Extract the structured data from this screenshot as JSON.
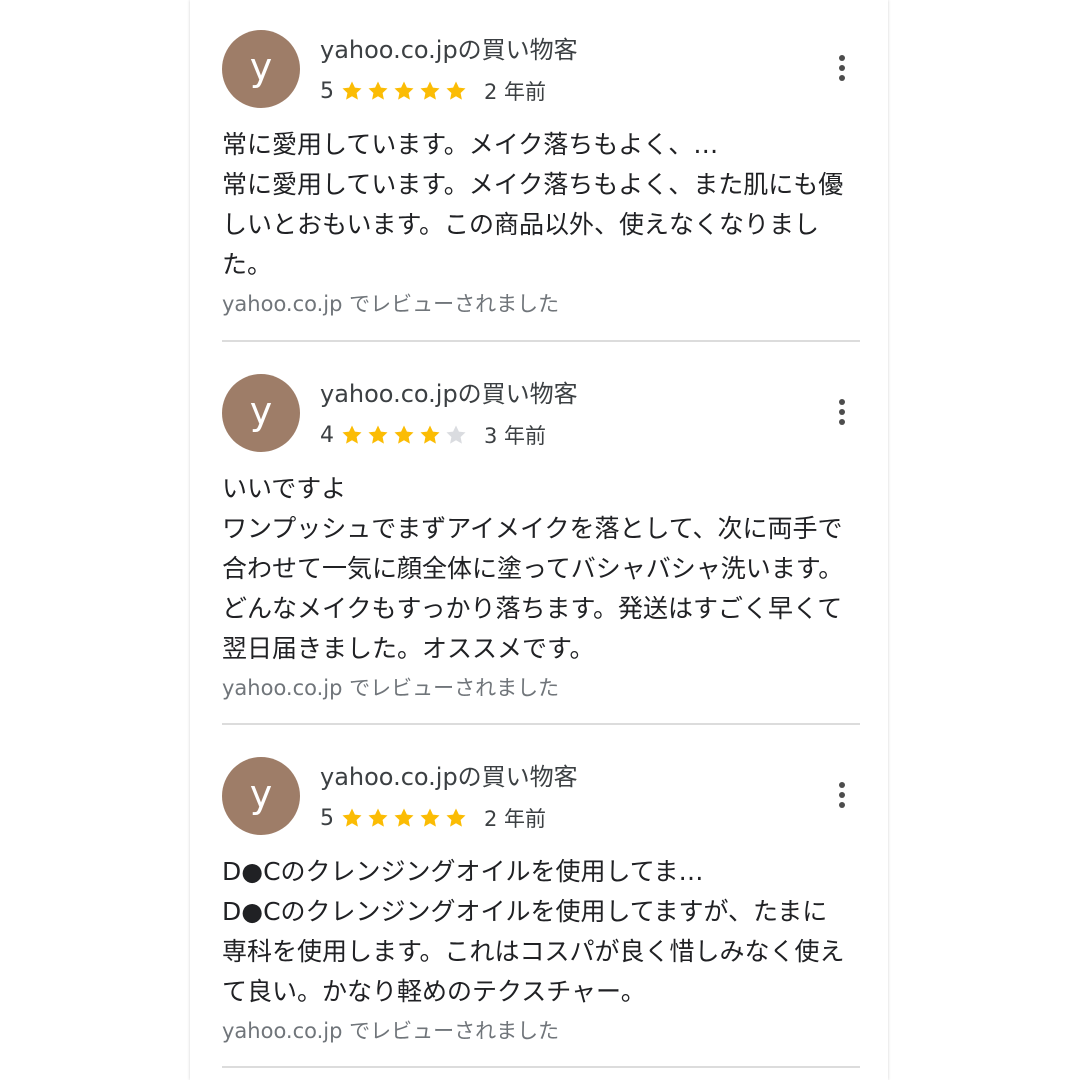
{
  "colors": {
    "avatar_bg": "#9e7d68",
    "star_filled": "#fbbc04",
    "star_empty": "#dadce0"
  },
  "reviews": [
    {
      "avatar_letter": "y",
      "author": "yahoo.co.jpの買い物客",
      "rating": "5",
      "rating_value": 5,
      "date": "2 年前",
      "snippet": "常に愛用しています。メイク落ちもよく、…",
      "body": "常に愛用しています。メイク落ちもよく、また肌にも優しいとおもいます。この商品以外、使えなくなりました。",
      "source": "yahoo.co.jp でレビューされました"
    },
    {
      "avatar_letter": "y",
      "author": "yahoo.co.jpの買い物客",
      "rating": "4",
      "rating_value": 4,
      "date": "3 年前",
      "snippet": "いいですよ",
      "body": "ワンプッシュでまずアイメイクを落として、次に両手で合わせて一気に顔全体に塗ってバシャバシャ洗います。どんなメイクもすっかり落ちます。発送はすごく早くて翌日届きました。オススメです。",
      "source": "yahoo.co.jp でレビューされました"
    },
    {
      "avatar_letter": "y",
      "author": "yahoo.co.jpの買い物客",
      "rating": "5",
      "rating_value": 5,
      "date": "2 年前",
      "snippet": "D●Cのクレンジングオイルを使用してま…",
      "body": "D●Cのクレンジングオイルを使用してますが、たまに専科を使用します。これはコスパが良く惜しみなく使えて良い。かなり軽めのテクスチャー。",
      "source": "yahoo.co.jp でレビューされました"
    }
  ]
}
